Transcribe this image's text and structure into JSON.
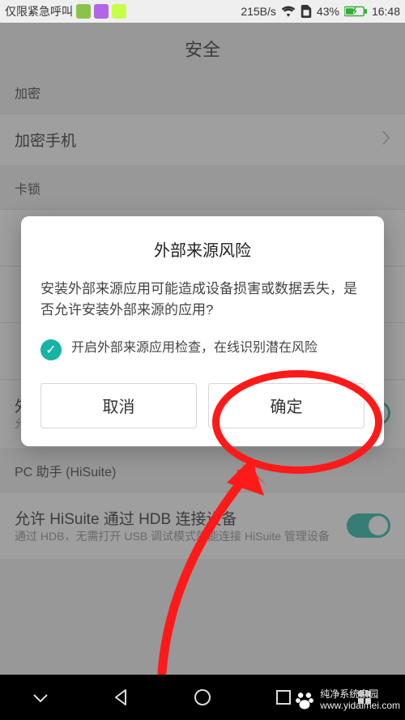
{
  "statusbar": {
    "network_label": "仅限紧急呼叫",
    "speed": "215B/s",
    "battery_pct": "43%",
    "time": "16:48"
  },
  "page": {
    "title": "安全"
  },
  "sections": {
    "encrypt_hdr": "加密",
    "encrypt_phone": "加密手机",
    "simlock_hdr": "卡锁",
    "external_install": {
      "label": "外部来源应用安装",
      "sub": "允许安装从外部来源获取的应用程序"
    },
    "pc_helper_hdr": "PC 助手 (HiSuite)",
    "hisuite": {
      "label": "允许 HiSuite 通过 HDB 连接设备",
      "sub": "通过 HDB，无需打开 USB 调试模式就能连接 HiSuite 管理设备"
    }
  },
  "dialog": {
    "title": "外部来源风险",
    "body": "安装外部来源应用可能造成设备损害或数据丢失，是否允许安装外部来源的应用?",
    "check_text": "开启外部来源应用检查，在线识别潜在风险",
    "cancel": "取消",
    "confirm": "确定"
  },
  "watermark": {
    "line1": "纯净系统家园",
    "line2": "www.yidaimei.com"
  }
}
